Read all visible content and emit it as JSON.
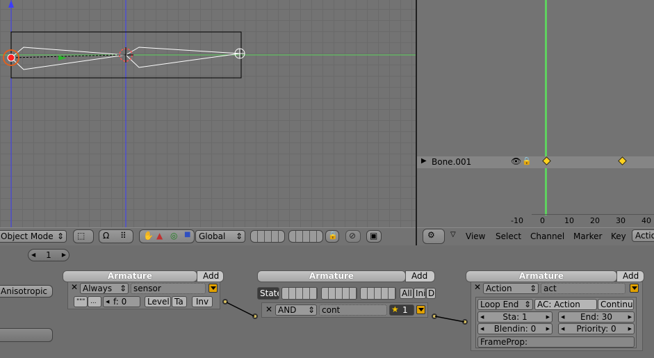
{
  "viewport": {
    "mode_select": "Object Mode",
    "orientation": "Global"
  },
  "action_editor": {
    "channel_name": "Bone.001",
    "ticks": [
      "-10",
      "0",
      "10",
      "20",
      "30",
      "40"
    ],
    "menus": [
      "View",
      "Select",
      "Channel",
      "Marker",
      "Key"
    ],
    "mode_button": "Action"
  },
  "logic": {
    "frame_value": "1",
    "anisotropic_label": "Anisotropic",
    "sensor": {
      "header": "Armature",
      "add": "Add",
      "type": "Always",
      "name": "sensor",
      "btn1": "\"\"\"",
      "btn2": "...",
      "freq": "f: 0",
      "level": "Level",
      "tap": "Ta",
      "inv": "Inv"
    },
    "controller": {
      "header": "Armature",
      "add": "Add",
      "state": "State",
      "all": "All",
      "ini": "Ini",
      "d": "D",
      "type": "AND",
      "name": "cont",
      "priority": "1"
    },
    "actuator": {
      "header": "Armature",
      "add": "Add",
      "type": "Action",
      "name": "act",
      "play_mode": "Loop End",
      "action": "AC: Action",
      "continue": "Continu",
      "start": "Sta: 1",
      "end": "End: 30",
      "blendin": "Blendin: 0",
      "priority": "Priority: 0",
      "frameprop": "FrameProp:"
    }
  },
  "colors": {
    "grid_bg": "#737373",
    "x_axis": "#5fd25f",
    "z_axis": "#4040ff",
    "current_frame": "#5fd25f",
    "keyframe": "#ffd21e"
  }
}
